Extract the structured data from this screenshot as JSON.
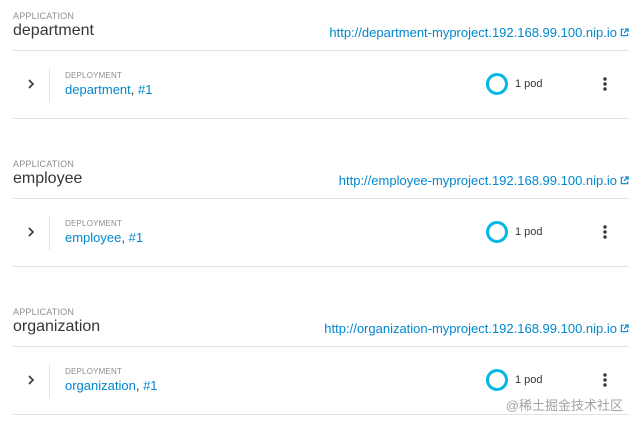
{
  "applications": [
    {
      "kicker": "APPLICATION",
      "name": "department",
      "route_url": "http://department-myproject.192.168.99.100.nip.io",
      "deployment": {
        "kicker": "DEPLOYMENT",
        "name": "department",
        "separator": ",",
        "revision": "#1",
        "pods_label": "1 pod",
        "pods_ready": 1,
        "pods_desired": 1
      }
    },
    {
      "kicker": "APPLICATION",
      "name": "employee",
      "route_url": "http://employee-myproject.192.168.99.100.nip.io",
      "deployment": {
        "kicker": "DEPLOYMENT",
        "name": "employee",
        "separator": ",",
        "revision": "#1",
        "pods_label": "1 pod",
        "pods_ready": 1,
        "pods_desired": 1
      }
    },
    {
      "kicker": "APPLICATION",
      "name": "organization",
      "route_url": "http://organization-myproject.192.168.99.100.nip.io",
      "deployment": {
        "kicker": "DEPLOYMENT",
        "name": "organization",
        "separator": ",",
        "revision": "#1",
        "pods_label": "1 pod",
        "pods_ready": 1,
        "pods_desired": 1
      }
    }
  ],
  "icons": {
    "route": "external-link-icon",
    "toggle": "chevron-right-icon",
    "pods": "pod-donut-icon",
    "menu": "kebab-menu-icon"
  },
  "colors": {
    "link": "#0088ce",
    "pod_ring": "#00b9e4",
    "text": "#363636",
    "muted": "#8b8d8f",
    "divider": "#e3e3e3"
  },
  "watermark": "@稀土掘金技术社区"
}
